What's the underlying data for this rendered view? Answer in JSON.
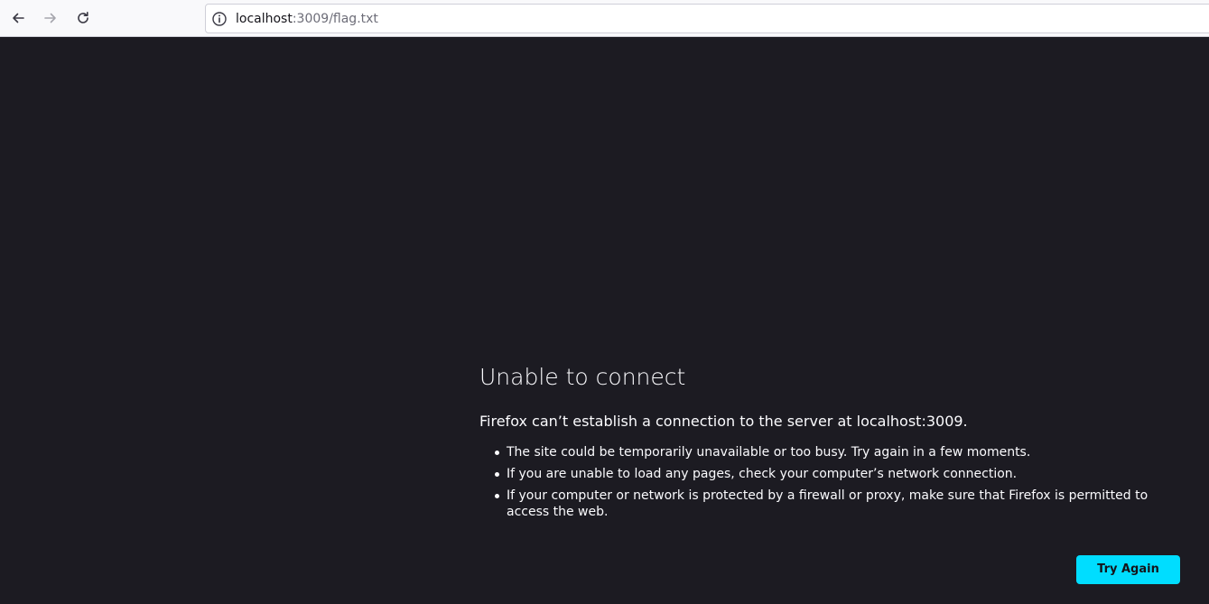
{
  "browser": {
    "back_icon": "arrow-left-icon",
    "forward_icon": "arrow-right-icon",
    "reload_icon": "reload-icon",
    "site_info_icon": "info-icon",
    "url_host": "localhost",
    "url_rest": ":3009/flag.txt"
  },
  "error_page": {
    "title": "Unable to connect",
    "description": "Firefox can’t establish a connection to the server at localhost:3009.",
    "tips": [
      "The site could be temporarily unavailable or too busy. Try again in a few moments.",
      "If you are unable to load any pages, check your computer’s network connection.",
      "If your computer or network is protected by a firewall or proxy, make sure that Firefox is permitted to access the web."
    ],
    "try_again_label": "Try Again"
  },
  "colors": {
    "background": "#1c1b22",
    "accent": "#00ddff",
    "text": "#fbfbfe"
  }
}
